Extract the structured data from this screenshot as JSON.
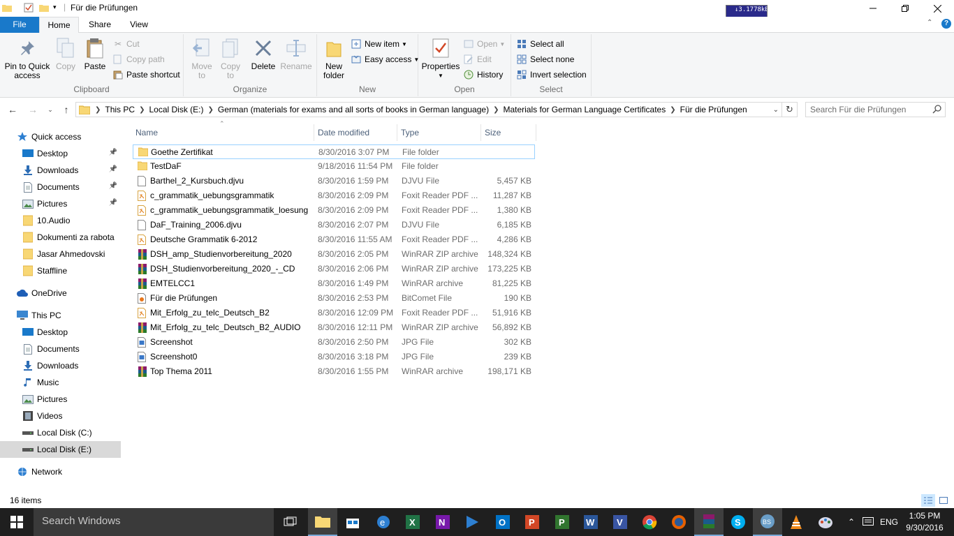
{
  "window": {
    "title": "Für die Prüfungen",
    "netmeter": "↓3.1778kB"
  },
  "tabs": {
    "file": "File",
    "home": "Home",
    "share": "Share",
    "view": "View"
  },
  "ribbon": {
    "clipboard": {
      "label": "Clipboard",
      "pin": "Pin to Quick access",
      "copy": "Copy",
      "paste": "Paste",
      "cut": "Cut",
      "copy_path": "Copy path",
      "paste_shortcut": "Paste shortcut"
    },
    "organize": {
      "label": "Organize",
      "move_to": "Move to",
      "copy_to": "Copy to",
      "delete": "Delete",
      "rename": "Rename"
    },
    "new": {
      "label": "New",
      "new_folder": "New folder",
      "new_item": "New item",
      "easy_access": "Easy access"
    },
    "open": {
      "label": "Open",
      "properties": "Properties",
      "open": "Open",
      "edit": "Edit",
      "history": "History"
    },
    "select": {
      "label": "Select",
      "select_all": "Select all",
      "select_none": "Select none",
      "invert": "Invert selection"
    }
  },
  "address": {
    "crumbs": [
      "This PC",
      "Local Disk (E:)",
      "German (materials for exams and all sorts of books in German language)",
      "Materials for German Language Certificates",
      "Für die Prüfungen"
    ],
    "search_placeholder": "Search Für die Prüfungen"
  },
  "nav": {
    "quick_access": "Quick access",
    "quick_items": [
      {
        "label": "Desktop",
        "pinned": true
      },
      {
        "label": "Downloads",
        "pinned": true
      },
      {
        "label": "Documents",
        "pinned": true
      },
      {
        "label": "Pictures",
        "pinned": true
      },
      {
        "label": "10.Audio",
        "pinned": false
      },
      {
        "label": "Dokumenti za rabota",
        "pinned": false
      },
      {
        "label": "Jasar Ahmedovski",
        "pinned": false
      },
      {
        "label": "Staffline",
        "pinned": false
      }
    ],
    "onedrive": "OneDrive",
    "this_pc": "This PC",
    "pc_items": [
      "Desktop",
      "Documents",
      "Downloads",
      "Music",
      "Pictures",
      "Videos",
      "Local Disk (C:)",
      "Local Disk (E:)"
    ],
    "network": "Network"
  },
  "columns": {
    "name": "Name",
    "date": "Date modified",
    "type": "Type",
    "size": "Size"
  },
  "files": [
    {
      "name": "Goethe Zertifikat",
      "date": "8/30/2016 3:07 PM",
      "type": "File folder",
      "size": "",
      "icon": "folder"
    },
    {
      "name": "TestDaF",
      "date": "9/18/2016 11:54 PM",
      "type": "File folder",
      "size": "",
      "icon": "folder"
    },
    {
      "name": "Barthel_2_Kursbuch.djvu",
      "date": "8/30/2016 1:59 PM",
      "type": "DJVU File",
      "size": "5,457 KB",
      "icon": "blank"
    },
    {
      "name": "c_grammatik_uebungsgrammatik",
      "date": "8/30/2016 2:09 PM",
      "type": "Foxit Reader PDF ...",
      "size": "11,287 KB",
      "icon": "pdf"
    },
    {
      "name": "c_grammatik_uebungsgrammatik_loesung",
      "date": "8/30/2016 2:09 PM",
      "type": "Foxit Reader PDF ...",
      "size": "1,380 KB",
      "icon": "pdf"
    },
    {
      "name": "DaF_Training_2006.djvu",
      "date": "8/30/2016 2:07 PM",
      "type": "DJVU File",
      "size": "6,185 KB",
      "icon": "blank"
    },
    {
      "name": "Deutsche Grammatik 6-2012",
      "date": "8/30/2016 11:55 AM",
      "type": "Foxit Reader PDF ...",
      "size": "4,286 KB",
      "icon": "pdf"
    },
    {
      "name": "DSH_amp_Studienvorbereitung_2020",
      "date": "8/30/2016 2:05 PM",
      "type": "WinRAR ZIP archive",
      "size": "148,324 KB",
      "icon": "rar"
    },
    {
      "name": "DSH_Studienvorbereitung_2020_-_CD",
      "date": "8/30/2016 2:06 PM",
      "type": "WinRAR ZIP archive",
      "size": "173,225 KB",
      "icon": "rar"
    },
    {
      "name": "EMTELCC1",
      "date": "8/30/2016 1:49 PM",
      "type": "WinRAR archive",
      "size": "81,225 KB",
      "icon": "rar"
    },
    {
      "name": "Für die Prüfungen",
      "date": "8/30/2016 2:53 PM",
      "type": "BitComet File",
      "size": "190 KB",
      "icon": "bitcomet"
    },
    {
      "name": "Mit_Erfolg_zu_telc_Deutsch_B2",
      "date": "8/30/2016 12:09 PM",
      "type": "Foxit Reader PDF ...",
      "size": "51,916 KB",
      "icon": "pdf"
    },
    {
      "name": "Mit_Erfolg_zu_telc_Deutsch_B2_AUDIO",
      "date": "8/30/2016 12:11 PM",
      "type": "WinRAR ZIP archive",
      "size": "56,892 KB",
      "icon": "rar"
    },
    {
      "name": "Screenshot",
      "date": "8/30/2016 2:50 PM",
      "type": "JPG File",
      "size": "302 KB",
      "icon": "jpg"
    },
    {
      "name": "Screenshot0",
      "date": "8/30/2016 3:18 PM",
      "type": "JPG File",
      "size": "239 KB",
      "icon": "jpg"
    },
    {
      "name": "Top Thema 2011",
      "date": "8/30/2016 1:55 PM",
      "type": "WinRAR archive",
      "size": "198,171 KB",
      "icon": "rar"
    }
  ],
  "status": {
    "items": "16 items"
  },
  "taskbar": {
    "search": "Search Windows",
    "lang": "ENG",
    "time": "1:05 PM",
    "date": "9/30/2016"
  },
  "colors": {
    "accent": "#1979ca",
    "folder": "#f8d775",
    "selection": "#99d1ff"
  }
}
